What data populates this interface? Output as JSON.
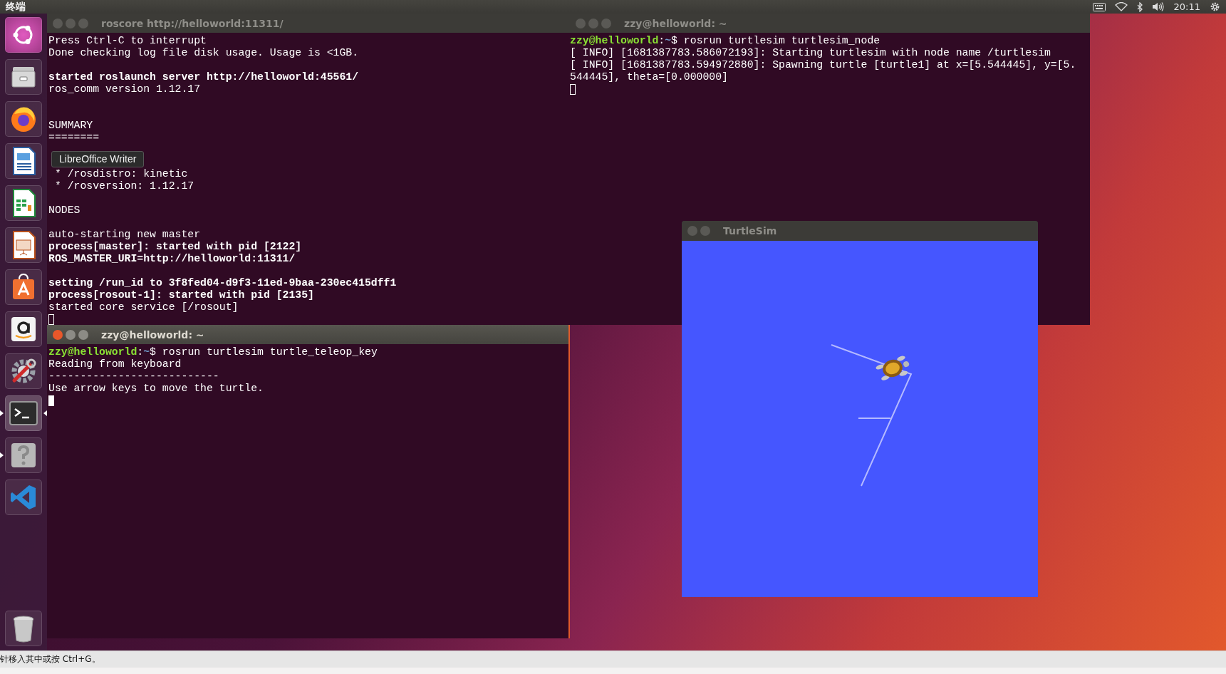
{
  "top_bar": {
    "app_title": "终端",
    "clock": "20:11"
  },
  "launcher": {
    "items": [
      {
        "kind": "dash",
        "running": false,
        "focused": false
      },
      {
        "kind": "files",
        "running": false,
        "focused": false
      },
      {
        "kind": "firefox",
        "running": false,
        "focused": false
      },
      {
        "kind": "writer",
        "running": false,
        "focused": false
      },
      {
        "kind": "calc",
        "running": false,
        "focused": false
      },
      {
        "kind": "impress",
        "running": false,
        "focused": false
      },
      {
        "kind": "software",
        "running": false,
        "focused": false
      },
      {
        "kind": "amazon",
        "running": false,
        "focused": false
      },
      {
        "kind": "settings",
        "running": false,
        "focused": false
      },
      {
        "kind": "terminal",
        "running": true,
        "focused": true
      },
      {
        "kind": "help",
        "running": true,
        "focused": false
      },
      {
        "kind": "vscode",
        "running": false,
        "focused": false
      },
      {
        "kind": "trash",
        "running": false,
        "focused": false
      }
    ]
  },
  "tooltip": "LibreOffice Writer",
  "terminals": [
    {
      "title": "roscore http://helloworld:11311/",
      "focused": false,
      "lines": [
        {
          "kind": "text",
          "text": "Press Ctrl-C to interrupt",
          "bold": false
        },
        {
          "kind": "text",
          "text": "Done checking log file disk usage. Usage is <1GB.",
          "bold": false
        },
        {
          "kind": "blank"
        },
        {
          "kind": "text",
          "text": "started roslaunch server http://helloworld:45561/",
          "bold": true
        },
        {
          "kind": "text",
          "text": "ros_comm version 1.12.17",
          "bold": false
        },
        {
          "kind": "blank"
        },
        {
          "kind": "blank"
        },
        {
          "kind": "text",
          "text": "SUMMARY",
          "bold": false
        },
        {
          "kind": "text",
          "text": "========",
          "bold": false
        },
        {
          "kind": "blank"
        },
        {
          "kind": "blank"
        },
        {
          "kind": "text",
          "text": " * /rosdistro: kinetic",
          "bold": false
        },
        {
          "kind": "text",
          "text": " * /rosversion: 1.12.17",
          "bold": false
        },
        {
          "kind": "blank"
        },
        {
          "kind": "text",
          "text": "NODES",
          "bold": false
        },
        {
          "kind": "blank"
        },
        {
          "kind": "text",
          "text": "auto-starting new master",
          "bold": false
        },
        {
          "kind": "text",
          "text": "process[master]: started with pid [2122]",
          "bold": true
        },
        {
          "kind": "text",
          "text": "ROS_MASTER_URI=http://helloworld:11311/",
          "bold": true
        },
        {
          "kind": "blank"
        },
        {
          "kind": "text",
          "text": "setting /run_id to 3f8fed04-d9f3-11ed-9baa-230ec415dff1",
          "bold": true
        },
        {
          "kind": "text",
          "text": "process[rosout-1]: started with pid [2135]",
          "bold": true
        },
        {
          "kind": "text",
          "text": "started core service [/rosout]",
          "bold": false
        }
      ]
    },
    {
      "title": "zzy@helloworld: ~",
      "focused": false,
      "lines": [
        {
          "kind": "prompt",
          "segments": [
            {
              "kind": "user",
              "text": "zzy@helloworld"
            },
            {
              "kind": "plain",
              "text": ":"
            },
            {
              "kind": "path",
              "text": "~"
            },
            {
              "kind": "plain",
              "text": "$ rosrun turtlesim turtlesim_node"
            }
          ]
        },
        {
          "kind": "text",
          "text": "[ INFO] [1681387783.586072193]: Starting turtlesim with node name /turtlesim",
          "bold": false
        },
        {
          "kind": "text",
          "text": "[ INFO] [1681387783.594972880]: Spawning turtle [turtle1] at x=[5.544445], y=[5.",
          "bold": false
        },
        {
          "kind": "text",
          "text": "544445], theta=[0.000000]",
          "bold": false
        }
      ]
    },
    {
      "title": "zzy@helloworld: ~",
      "focused": true,
      "lines": [
        {
          "kind": "prompt",
          "segments": [
            {
              "kind": "user",
              "text": "zzy@helloworld"
            },
            {
              "kind": "plain",
              "text": ":"
            },
            {
              "kind": "path",
              "text": "~"
            },
            {
              "kind": "plain",
              "text": "$ rosrun turtlesim turtle_teleop_key"
            }
          ]
        },
        {
          "kind": "text",
          "text": "Reading from keyboard",
          "bold": false
        },
        {
          "kind": "text",
          "text": "---------------------------",
          "bold": false
        },
        {
          "kind": "text",
          "text": "Use arrow keys to move the turtle.",
          "bold": false
        }
      ]
    }
  ],
  "turtlesim": {
    "title": "TurtleSim",
    "focused": false
  },
  "status_bar": {
    "text": "针移入其中或按 Ctrl+G。"
  }
}
